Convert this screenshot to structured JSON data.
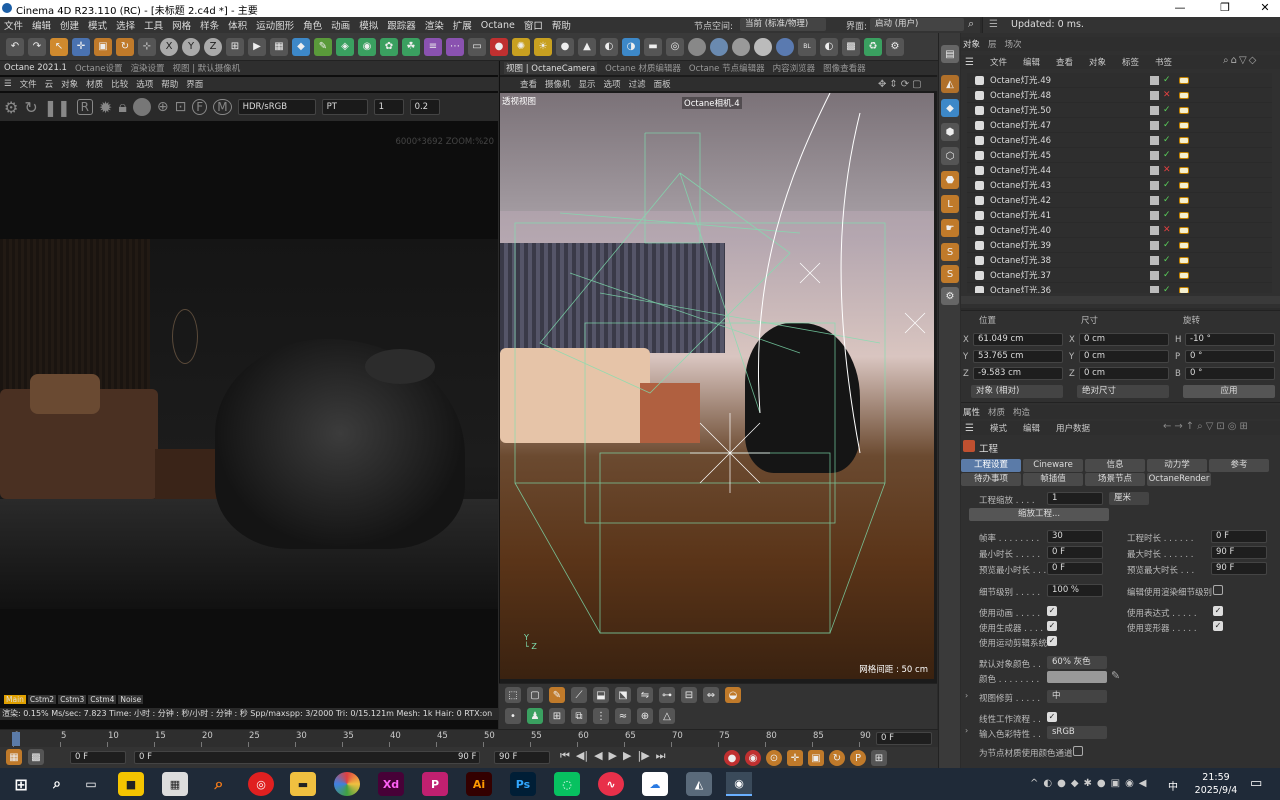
{
  "window": {
    "title": "Cinema 4D R23.110 (RC) - [未标题 2.c4d *] - 主要",
    "minimize": "—",
    "maximize": "❐",
    "close": "✕"
  },
  "menu": [
    "文件",
    "编辑",
    "创建",
    "模式",
    "选择",
    "工具",
    "网格",
    "样条",
    "体积",
    "运动图形",
    "角色",
    "动画",
    "模拟",
    "跟踪器",
    "渲染",
    "扩展",
    "Octane",
    "窗口",
    "帮助"
  ],
  "node_space": {
    "label": "节点空间:",
    "value": "当前 (标准/物理)"
  },
  "layout": {
    "label": "界面:",
    "value": "启动 (用户)"
  },
  "status_top": "Updated: 0 ms.",
  "octane_panel": {
    "tabs": [
      "Octane 2021.1",
      "Octane设置",
      "渲染设置",
      "视图 | 默认摄像机"
    ],
    "menu": [
      "文件",
      "云",
      "对象",
      "材质",
      "比较",
      "选项",
      "帮助",
      "界面"
    ],
    "color_mode": "HDR/sRGB",
    "kernel": "PT",
    "val1": "1",
    "val2": "0.2",
    "overlay": "6000*3692 ZOOM:%20",
    "bottom_tabs": [
      "Main",
      "Cstm2",
      "Cstm3",
      "Cstm4",
      "Noise"
    ],
    "stats": "渲染: 0.15%  Ms/sec: 7.823   Time: 小时 : 分钟 : 秒/小时 : 分钟 : 秒   Spp/maxspp: 3/2000   Tri: 0/15.121m   Mesh: 1k   Hair: 0   RTX:on"
  },
  "viewport": {
    "tabs": [
      "视图 | OctaneCamera",
      "Octane 材质编辑器",
      "Octane 节点编辑器",
      "内容浏览器",
      "图像查看器"
    ],
    "menu": [
      "查看",
      "摄像机",
      "显示",
      "选项",
      "过滤",
      "面板"
    ],
    "label": "透视视图",
    "camera": "Octane相机.4",
    "grid": "网格间距 : 50 cm"
  },
  "objects": {
    "tabs": [
      "对象",
      "层",
      "场次"
    ],
    "menu": [
      "文件",
      "编辑",
      "查看",
      "对象",
      "标签",
      "书签"
    ],
    "items": [
      {
        "name": "Octane灯光.49",
        "ok": true
      },
      {
        "name": "Octane灯光.48",
        "ok": false
      },
      {
        "name": "Octane灯光.50",
        "ok": true
      },
      {
        "name": "Octane灯光.47",
        "ok": true
      },
      {
        "name": "Octane灯光.46",
        "ok": true
      },
      {
        "name": "Octane灯光.45",
        "ok": true
      },
      {
        "name": "Octane灯光.44",
        "ok": false
      },
      {
        "name": "Octane灯光.43",
        "ok": true
      },
      {
        "name": "Octane灯光.42",
        "ok": true
      },
      {
        "name": "Octane灯光.41",
        "ok": true
      },
      {
        "name": "Octane灯光.40",
        "ok": false
      },
      {
        "name": "Octane灯光.39",
        "ok": true
      },
      {
        "name": "Octane灯光.38",
        "ok": true
      },
      {
        "name": "Octane灯光.37",
        "ok": true
      },
      {
        "name": "Octane灯光.36",
        "ok": true
      }
    ]
  },
  "coords": {
    "headers": [
      "位置",
      "尺寸",
      "旋转"
    ],
    "rows": [
      {
        "a": "X",
        "av": "61.049 cm",
        "b": "X",
        "bv": "0 cm",
        "c": "H",
        "cv": "-10 °"
      },
      {
        "a": "Y",
        "av": "53.765 cm",
        "b": "Y",
        "bv": "0 cm",
        "c": "P",
        "cv": "0 °"
      },
      {
        "a": "Z",
        "av": "-9.583 cm",
        "b": "Z",
        "bv": "0 cm",
        "c": "B",
        "cv": "0 °"
      }
    ],
    "mode1": "对象 (相对)",
    "mode2": "绝对尺寸",
    "apply": "应用"
  },
  "attributes": {
    "tabs": [
      "属性",
      "材质",
      "构造"
    ],
    "menu": [
      "模式",
      "编辑",
      "用户数据"
    ],
    "section": "工程",
    "ptabs1": [
      "工程设置",
      "Cineware",
      "信息",
      "动力学",
      "参考"
    ],
    "ptabs2": [
      "待办事项",
      "帧插值",
      "场景节点",
      "OctaneRender"
    ],
    "scale_label": "工程缩放 . . . .",
    "scale_val": "1",
    "scale_unit": "厘米",
    "scale_btn": "缩放工程...",
    "fps_l": "帧率 . . . . . . . .",
    "fps": "30",
    "dur_l": "工程时长 . . . . . .",
    "dur": "0 F",
    "min_l": "最小时长 . . . . .",
    "min": "0 F",
    "max_l": "最大时长 . . . . . .",
    "max": "90 F",
    "pmin_l": "预览最小时长 . . .",
    "pmin": "0 F",
    "pmax_l": "预览最大时长 . . .",
    "pmax": "90 F",
    "lod_l": "细节级别 . . . . .",
    "lod": "100 %",
    "rlod_l": "编辑使用渲染细节级别",
    "anim_l": "使用动画 . . . . .",
    "expr_l": "使用表达式 . . . . .",
    "gen_l": "使用生成器 . . . .",
    "def_l": "使用变形器 . . . . .",
    "mo_l": "使用运动剪辑系统",
    "dcol_l": "默认对象颜色 . .",
    "dcol": "60% 灰色",
    "col_l": "颜色 . . . . . . . .",
    "vclip_l": "视图修剪 . . . . .",
    "vclip": "中",
    "lin_l": "线性工作流程 . .",
    "icp_l": "输入色彩特性 . .",
    "icp": "sRGB",
    "node_l": "为节点材质使用颜色通道"
  },
  "timeline": {
    "ticks": [
      "0",
      "5",
      "10",
      "15",
      "20",
      "25",
      "30",
      "35",
      "40",
      "45",
      "50",
      "55",
      "60",
      "65",
      "70",
      "75",
      "80",
      "85",
      "90"
    ],
    "frame": "0 F",
    "start": "0 F",
    "cur": "0 F",
    "end1": "90 F",
    "end2": "90 F"
  },
  "tray": {
    "time": "21:59",
    "date": "2025/9/4",
    "ime": "中"
  },
  "taskbar_apps": [
    "Xd",
    "Ai",
    "Ps"
  ]
}
